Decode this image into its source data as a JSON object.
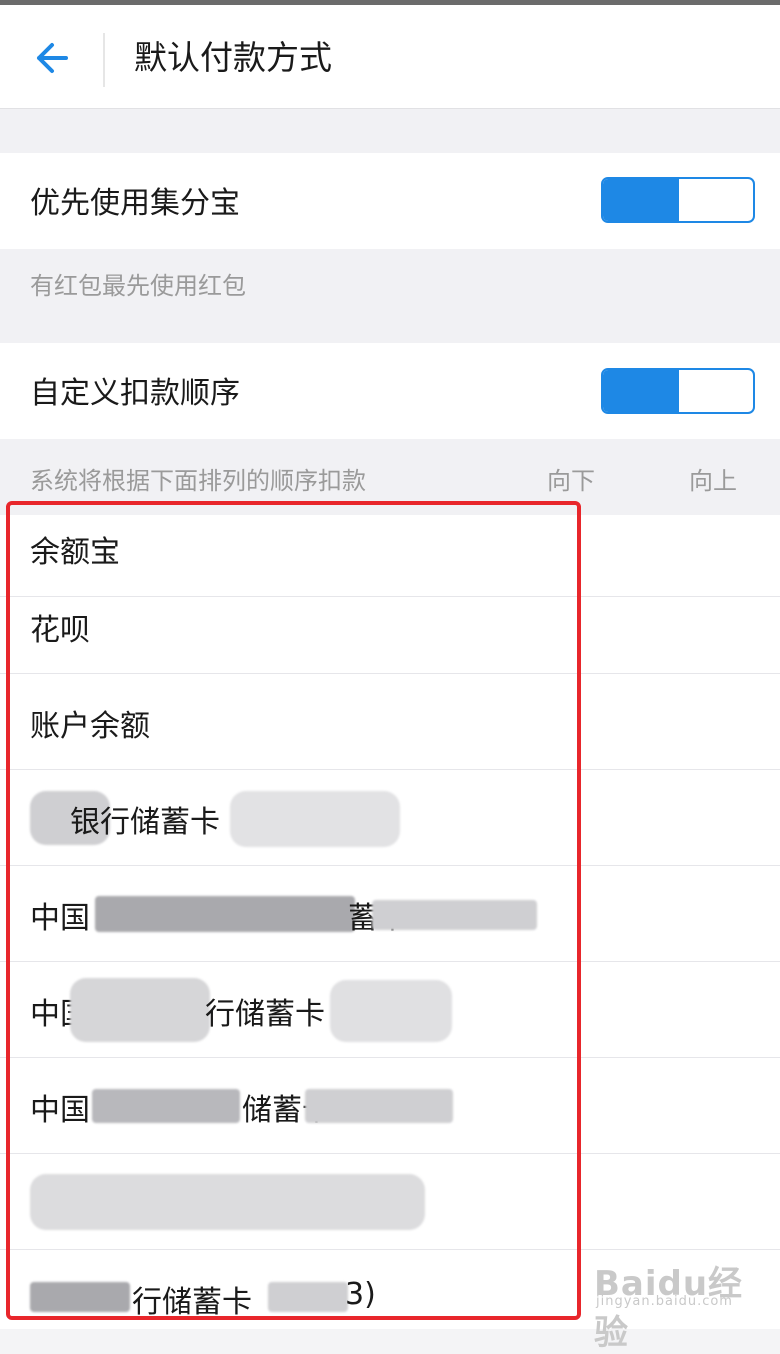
{
  "header": {
    "title": "默认付款方式"
  },
  "section1": {
    "label": "优先使用集分宝",
    "toggle_on": true,
    "hint": "有红包最先使用红包"
  },
  "section2": {
    "label": "自定义扣款顺序",
    "toggle_on": true,
    "hint": "系统将根据下面排列的顺序扣款",
    "down_label": "向下",
    "up_label": "向上"
  },
  "payment_list": [
    {
      "label": "余额宝"
    },
    {
      "label": "花呗"
    },
    {
      "label": "账户余额"
    },
    {
      "label": "银行储蓄卡",
      "masked": true
    },
    {
      "label": "中国",
      "suffix": "蓄卡",
      "masked": true
    },
    {
      "label": "中国",
      "suffix": "行储蓄卡",
      "masked": true
    },
    {
      "label": "中国",
      "suffix": "储蓄卡",
      "masked": true
    },
    {
      "label": "",
      "masked": true
    },
    {
      "label": "行储蓄卡",
      "suffix": "3)",
      "masked": true
    }
  ],
  "watermark": {
    "logo": "Baidu经验",
    "sub": "jingyan.baidu.com"
  },
  "colors": {
    "accent": "#1e88e5",
    "highlight_box": "#e8262b"
  },
  "icons": {
    "back": "arrow-left-icon"
  }
}
